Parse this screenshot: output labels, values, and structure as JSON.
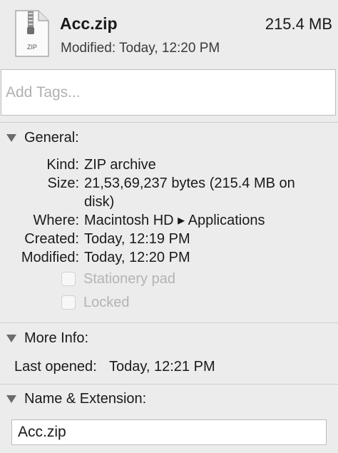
{
  "file": {
    "name": "Acc.zip",
    "size": "215.4 MB",
    "modified_line": "Modified: Today, 12:20 PM",
    "icon": "zip-file-icon",
    "icon_label": "ZIP"
  },
  "tags": {
    "placeholder": "Add Tags..."
  },
  "general": {
    "title": "General:",
    "rows": [
      {
        "label": "Kind:",
        "value": "ZIP archive"
      },
      {
        "label": "Size:",
        "value": "21,53,69,237 bytes (215.4 MB on disk)"
      },
      {
        "label": "Where:",
        "value": "Macintosh HD ▸ Applications"
      },
      {
        "label": "Created:",
        "value": "Today, 12:19 PM"
      },
      {
        "label": "Modified:",
        "value": "Today, 12:20 PM"
      }
    ],
    "checkboxes": [
      {
        "label": "Stationery pad",
        "checked": false,
        "enabled": false
      },
      {
        "label": "Locked",
        "checked": false,
        "enabled": false
      }
    ]
  },
  "more_info": {
    "title": "More Info:",
    "last_opened_label": "Last opened:",
    "last_opened_value": "Today, 12:21 PM"
  },
  "name_extension": {
    "title": "Name & Extension:",
    "value": "Acc.zip"
  }
}
